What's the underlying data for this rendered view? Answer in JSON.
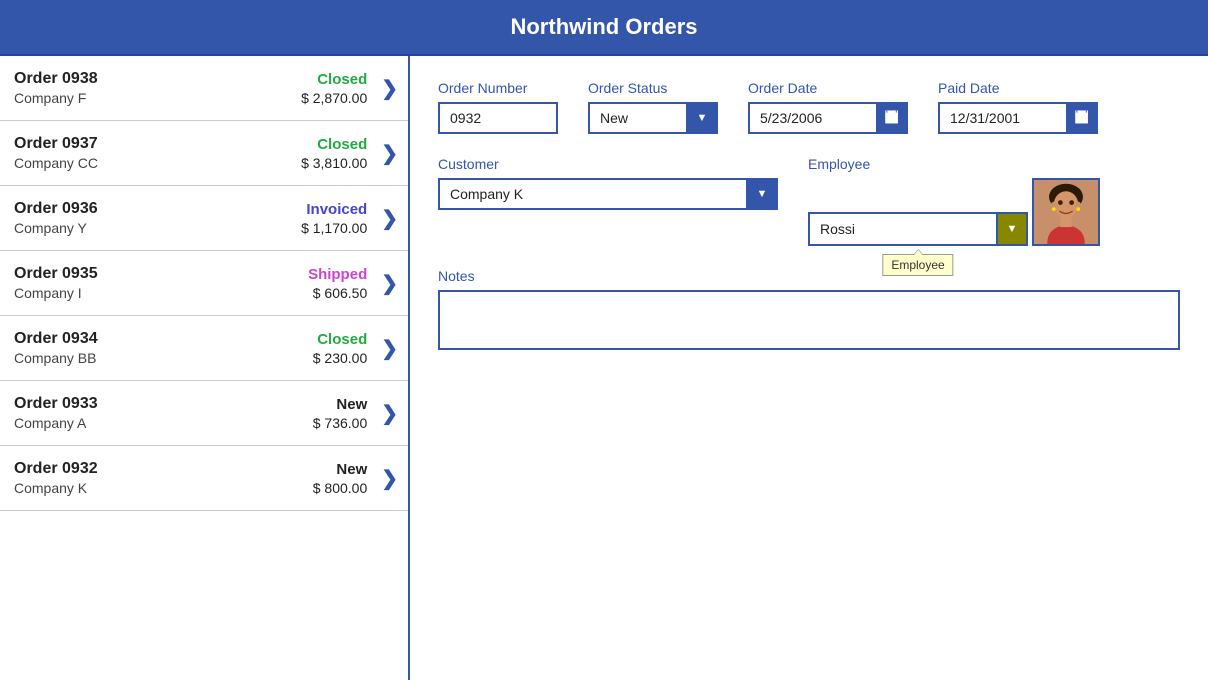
{
  "app": {
    "title": "Northwind Orders"
  },
  "orders": [
    {
      "number": "Order 0938",
      "company": "Company F",
      "status": "Closed",
      "statusClass": "status-closed",
      "amount": "$ 2,870.00"
    },
    {
      "number": "Order 0937",
      "company": "Company CC",
      "status": "Closed",
      "statusClass": "status-closed",
      "amount": "$ 3,810.00"
    },
    {
      "number": "Order 0936",
      "company": "Company Y",
      "status": "Invoiced",
      "statusClass": "status-invoiced",
      "amount": "$ 1,170.00"
    },
    {
      "number": "Order 0935",
      "company": "Company I",
      "status": "Shipped",
      "statusClass": "status-shipped",
      "amount": "$ 606.50"
    },
    {
      "number": "Order 0934",
      "company": "Company BB",
      "status": "Closed",
      "statusClass": "status-closed",
      "amount": "$ 230.00"
    },
    {
      "number": "Order 0933",
      "company": "Company A",
      "status": "New",
      "statusClass": "status-new",
      "amount": "$ 736.00"
    },
    {
      "number": "Order 0932",
      "company": "Company K",
      "status": "New",
      "statusClass": "status-new",
      "amount": "$ 800.00"
    }
  ],
  "form": {
    "order_number_label": "Order Number",
    "order_number_value": "0932",
    "order_status_label": "Order Status",
    "order_status_value": "New",
    "order_date_label": "Order Date",
    "order_date_value": "5/23/2006",
    "paid_date_label": "Paid Date",
    "paid_date_value": "12/31/2001",
    "customer_label": "Customer",
    "customer_value": "Company K",
    "employee_label": "Employee",
    "employee_value": "Rossi",
    "employee_tooltip": "Employee",
    "notes_label": "Notes",
    "notes_value": ""
  },
  "icons": {
    "chevron_right": "❯",
    "calendar": "▦"
  }
}
